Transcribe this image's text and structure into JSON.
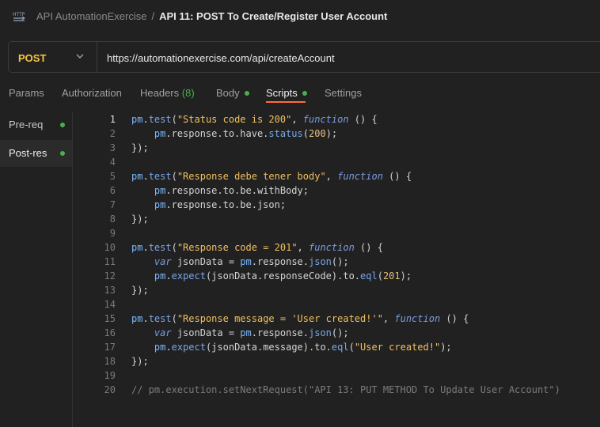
{
  "header": {
    "collection": "API AutomationExercise",
    "separator": "/",
    "request_title": "API 11: POST To Create/Register User Account"
  },
  "request": {
    "method": "POST",
    "url": "https://automationexercise.com/api/createAccount"
  },
  "tabs": {
    "params": "Params",
    "authorization": "Authorization",
    "headers": "Headers",
    "headers_count": "(8)",
    "body": "Body",
    "scripts": "Scripts",
    "settings": "Settings"
  },
  "script_types": {
    "pre_req": "Pre-req",
    "post_res": "Post-res"
  },
  "editor": {
    "active_line": 1,
    "lines": [
      {
        "n": "1",
        "t": [
          [
            "obj",
            "pm"
          ],
          [
            "pl",
            "."
          ],
          [
            "fn",
            "test"
          ],
          [
            "pl",
            "("
          ],
          [
            "str",
            "\"Status code is 200\""
          ],
          [
            "pl",
            ", "
          ],
          [
            "kw",
            "function"
          ],
          [
            "pl",
            " () {"
          ]
        ]
      },
      {
        "n": "2",
        "t": [
          [
            "pl",
            "    "
          ],
          [
            "obj",
            "pm"
          ],
          [
            "pl",
            ".response.to.have."
          ],
          [
            "fn",
            "status"
          ],
          [
            "pl",
            "("
          ],
          [
            "num",
            "200"
          ],
          [
            "pl",
            ");"
          ]
        ]
      },
      {
        "n": "3",
        "t": [
          [
            "pl",
            "});"
          ]
        ]
      },
      {
        "n": "4",
        "t": []
      },
      {
        "n": "5",
        "t": [
          [
            "obj",
            "pm"
          ],
          [
            "pl",
            "."
          ],
          [
            "fn",
            "test"
          ],
          [
            "pl",
            "("
          ],
          [
            "str",
            "\"Response debe tener body\""
          ],
          [
            "pl",
            ", "
          ],
          [
            "kw",
            "function"
          ],
          [
            "pl",
            " () {"
          ]
        ]
      },
      {
        "n": "6",
        "t": [
          [
            "pl",
            "    "
          ],
          [
            "obj",
            "pm"
          ],
          [
            "pl",
            ".response.to.be.withBody;"
          ]
        ]
      },
      {
        "n": "7",
        "t": [
          [
            "pl",
            "    "
          ],
          [
            "obj",
            "pm"
          ],
          [
            "pl",
            ".response.to.be.json;"
          ]
        ]
      },
      {
        "n": "8",
        "t": [
          [
            "pl",
            "});"
          ]
        ]
      },
      {
        "n": "9",
        "t": []
      },
      {
        "n": "10",
        "t": [
          [
            "obj",
            "pm"
          ],
          [
            "pl",
            "."
          ],
          [
            "fn",
            "test"
          ],
          [
            "pl",
            "("
          ],
          [
            "str",
            "\"Response code = 201\""
          ],
          [
            "pl",
            ", "
          ],
          [
            "kw",
            "function"
          ],
          [
            "pl",
            " () {"
          ]
        ]
      },
      {
        "n": "11",
        "t": [
          [
            "pl",
            "    "
          ],
          [
            "kw",
            "var"
          ],
          [
            "pl",
            " jsonData = "
          ],
          [
            "obj",
            "pm"
          ],
          [
            "pl",
            ".response."
          ],
          [
            "fn",
            "json"
          ],
          [
            "pl",
            "();"
          ]
        ]
      },
      {
        "n": "12",
        "t": [
          [
            "pl",
            "    "
          ],
          [
            "obj",
            "pm"
          ],
          [
            "pl",
            "."
          ],
          [
            "fn",
            "expect"
          ],
          [
            "pl",
            "(jsonData.responseCode).to."
          ],
          [
            "fn",
            "eql"
          ],
          [
            "pl",
            "("
          ],
          [
            "num",
            "201"
          ],
          [
            "pl",
            ");"
          ]
        ]
      },
      {
        "n": "13",
        "t": [
          [
            "pl",
            "});"
          ]
        ]
      },
      {
        "n": "14",
        "t": []
      },
      {
        "n": "15",
        "t": [
          [
            "obj",
            "pm"
          ],
          [
            "pl",
            "."
          ],
          [
            "fn",
            "test"
          ],
          [
            "pl",
            "("
          ],
          [
            "str",
            "\"Response message = 'User created!'\""
          ],
          [
            "pl",
            ", "
          ],
          [
            "kw",
            "function"
          ],
          [
            "pl",
            " () {"
          ]
        ]
      },
      {
        "n": "16",
        "t": [
          [
            "pl",
            "    "
          ],
          [
            "kw",
            "var"
          ],
          [
            "pl",
            " jsonData = "
          ],
          [
            "obj",
            "pm"
          ],
          [
            "pl",
            ".response."
          ],
          [
            "fn",
            "json"
          ],
          [
            "pl",
            "();"
          ]
        ]
      },
      {
        "n": "17",
        "t": [
          [
            "pl",
            "    "
          ],
          [
            "obj",
            "pm"
          ],
          [
            "pl",
            "."
          ],
          [
            "fn",
            "expect"
          ],
          [
            "pl",
            "(jsonData.message).to."
          ],
          [
            "fn",
            "eql"
          ],
          [
            "pl",
            "("
          ],
          [
            "str",
            "\"User created!\""
          ],
          [
            "pl",
            ");"
          ]
        ]
      },
      {
        "n": "18",
        "t": [
          [
            "pl",
            "});"
          ]
        ]
      },
      {
        "n": "19",
        "t": []
      },
      {
        "n": "20",
        "t": [
          [
            "cmt",
            "// pm.execution.setNextRequest(\"API 13: PUT METHOD To Update User Account\")"
          ]
        ]
      }
    ]
  },
  "colors": {
    "method": "#f5c542",
    "active_tab_underline": "#ff6c37",
    "status_dot": "#4cae4f",
    "string": "#f0c060",
    "keyword": "#7a9ce0",
    "comment": "#7c7c7c"
  }
}
